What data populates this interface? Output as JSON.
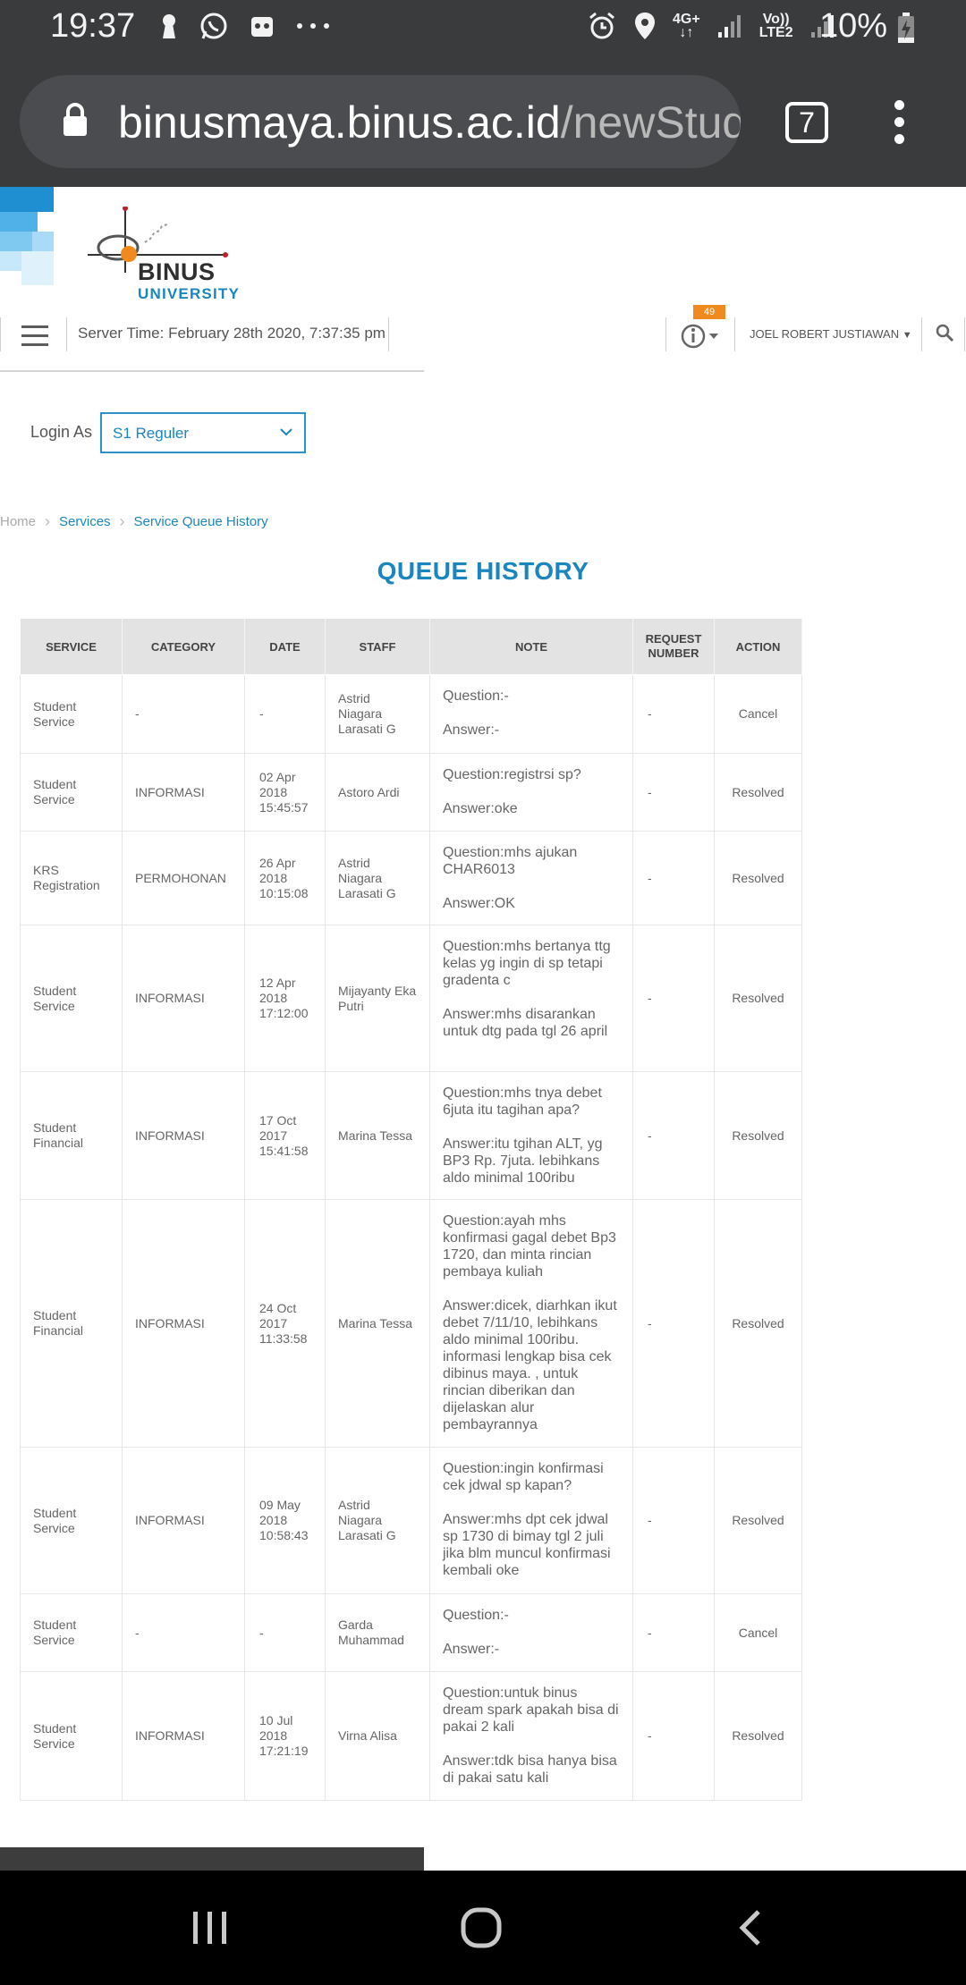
{
  "status_bar": {
    "time": "19:37",
    "battery": "10%",
    "network_top": "4G+",
    "volte_top": "Vo))",
    "volte_bottom": "LTE2",
    "icons": [
      "keyhole-icon",
      "whatsapp-icon",
      "app-icon",
      "more-dots-icon",
      "alarm-icon",
      "location-icon",
      "signal-icon",
      "battery-charging-icon"
    ]
  },
  "browser": {
    "url_domain": "binusmaya.binus.ac.id",
    "url_path": "/newStude",
    "tab_count": "7"
  },
  "header": {
    "logo_line1": "BINUS",
    "logo_line2": "UNIVERSITY",
    "server_time": "Server Time: February 28th 2020, 7:37:35 pm",
    "notification_count": "49",
    "user_name": "JOEL ROBERT JUSTIAWAN"
  },
  "login_as": {
    "label": "Login As",
    "selected": "S1 Reguler"
  },
  "breadcrumb": [
    "Home",
    "Services",
    "Service Queue History"
  ],
  "page_title": "QUEUE HISTORY",
  "table": {
    "headers": [
      "SERVICE",
      "CATEGORY",
      "DATE",
      "STAFF",
      "NOTE",
      "REQUEST NUMBER",
      "ACTION"
    ],
    "rows": [
      {
        "service": "Student Service",
        "category": "-",
        "date": "-",
        "staff": "Astrid Niagara Larasati G",
        "question": "Question:-",
        "answer": "Answer:-",
        "request": "-",
        "action": "Cancel"
      },
      {
        "service": "Student Service",
        "category": "INFORMASI",
        "date": "02 Apr 2018 15:45:57",
        "staff": "Astoro Ardi",
        "question": "Question:registrsi sp?",
        "answer": "Answer:oke",
        "request": "-",
        "action": "Resolved"
      },
      {
        "service": "KRS Registration",
        "category": "PERMOHONAN",
        "date": "26 Apr 2018 10:15:08",
        "staff": "Astrid Niagara Larasati G",
        "question": "Question:mhs ajukan CHAR6013",
        "answer": "Answer:OK",
        "request": "-",
        "action": "Resolved"
      },
      {
        "service": "Student Service",
        "category": "INFORMASI",
        "date": "12 Apr 2018 17:12:00",
        "staff": "Mijayanty Eka Putri",
        "question": "Question:mhs bertanya ttg kelas yg ingin di sp tetapi gradenta c",
        "answer": "Answer:mhs disarankan untuk dtg pada tgl 26 april",
        "request": "-",
        "action": "Resolved"
      },
      {
        "service": "Student Financial",
        "category": "INFORMASI",
        "date": "17 Oct 2017 15:41:58",
        "staff": "Marina Tessa",
        "question": "Question:mhs tnya debet 6juta itu tagihan apa?",
        "answer": "Answer:itu tgihan ALT, yg BP3 Rp. 7juta. lebihkans aldo minimal 100ribu",
        "request": "-",
        "action": "Resolved"
      },
      {
        "service": "Student Financial",
        "category": "INFORMASI",
        "date": "24 Oct 2017 11:33:58",
        "staff": "Marina Tessa",
        "question": "Question:ayah mhs konfirmasi gagal debet Bp3 1720, dan minta rincian pembaya kuliah",
        "answer": "Answer:dicek, diarhkan ikut debet 7/11/10, lebihkans aldo minimal 100ribu. informasi lengkap bisa cek dibinus maya. , untuk rincian diberikan dan dijelaskan alur pembayrannya",
        "request": "-",
        "action": "Resolved"
      },
      {
        "service": "Student Service",
        "category": "INFORMASI",
        "date": "09 May 2018 10:58:43",
        "staff": "Astrid Niagara Larasati G",
        "question": "Question:ingin konfirmasi cek jdwal sp kapan?",
        "answer": "Answer:mhs dpt cek jdwal sp 1730 di bimay tgl 2 juli jika blm muncul konfirmasi kembali oke",
        "request": "-",
        "action": "Resolved"
      },
      {
        "service": "Student Service",
        "category": "-",
        "date": "-",
        "staff": "Garda Muhammad",
        "question": "Question:-",
        "answer": "Answer:-",
        "request": "-",
        "action": "Cancel"
      },
      {
        "service": "Student Service",
        "category": "INFORMASI",
        "date": "10 Jul 2018 17:21:19",
        "staff": "Virna Alisa",
        "question": "Question:untuk binus dream spark apakah bisa di pakai 2 kali",
        "answer": "Answer:tdk bisa hanya bisa di pakai satu kali",
        "request": "-",
        "action": "Resolved"
      }
    ]
  },
  "colors": {
    "accent": "#1a86bf",
    "badge": "#f08a1e",
    "chrome": "#3a3b3d"
  }
}
